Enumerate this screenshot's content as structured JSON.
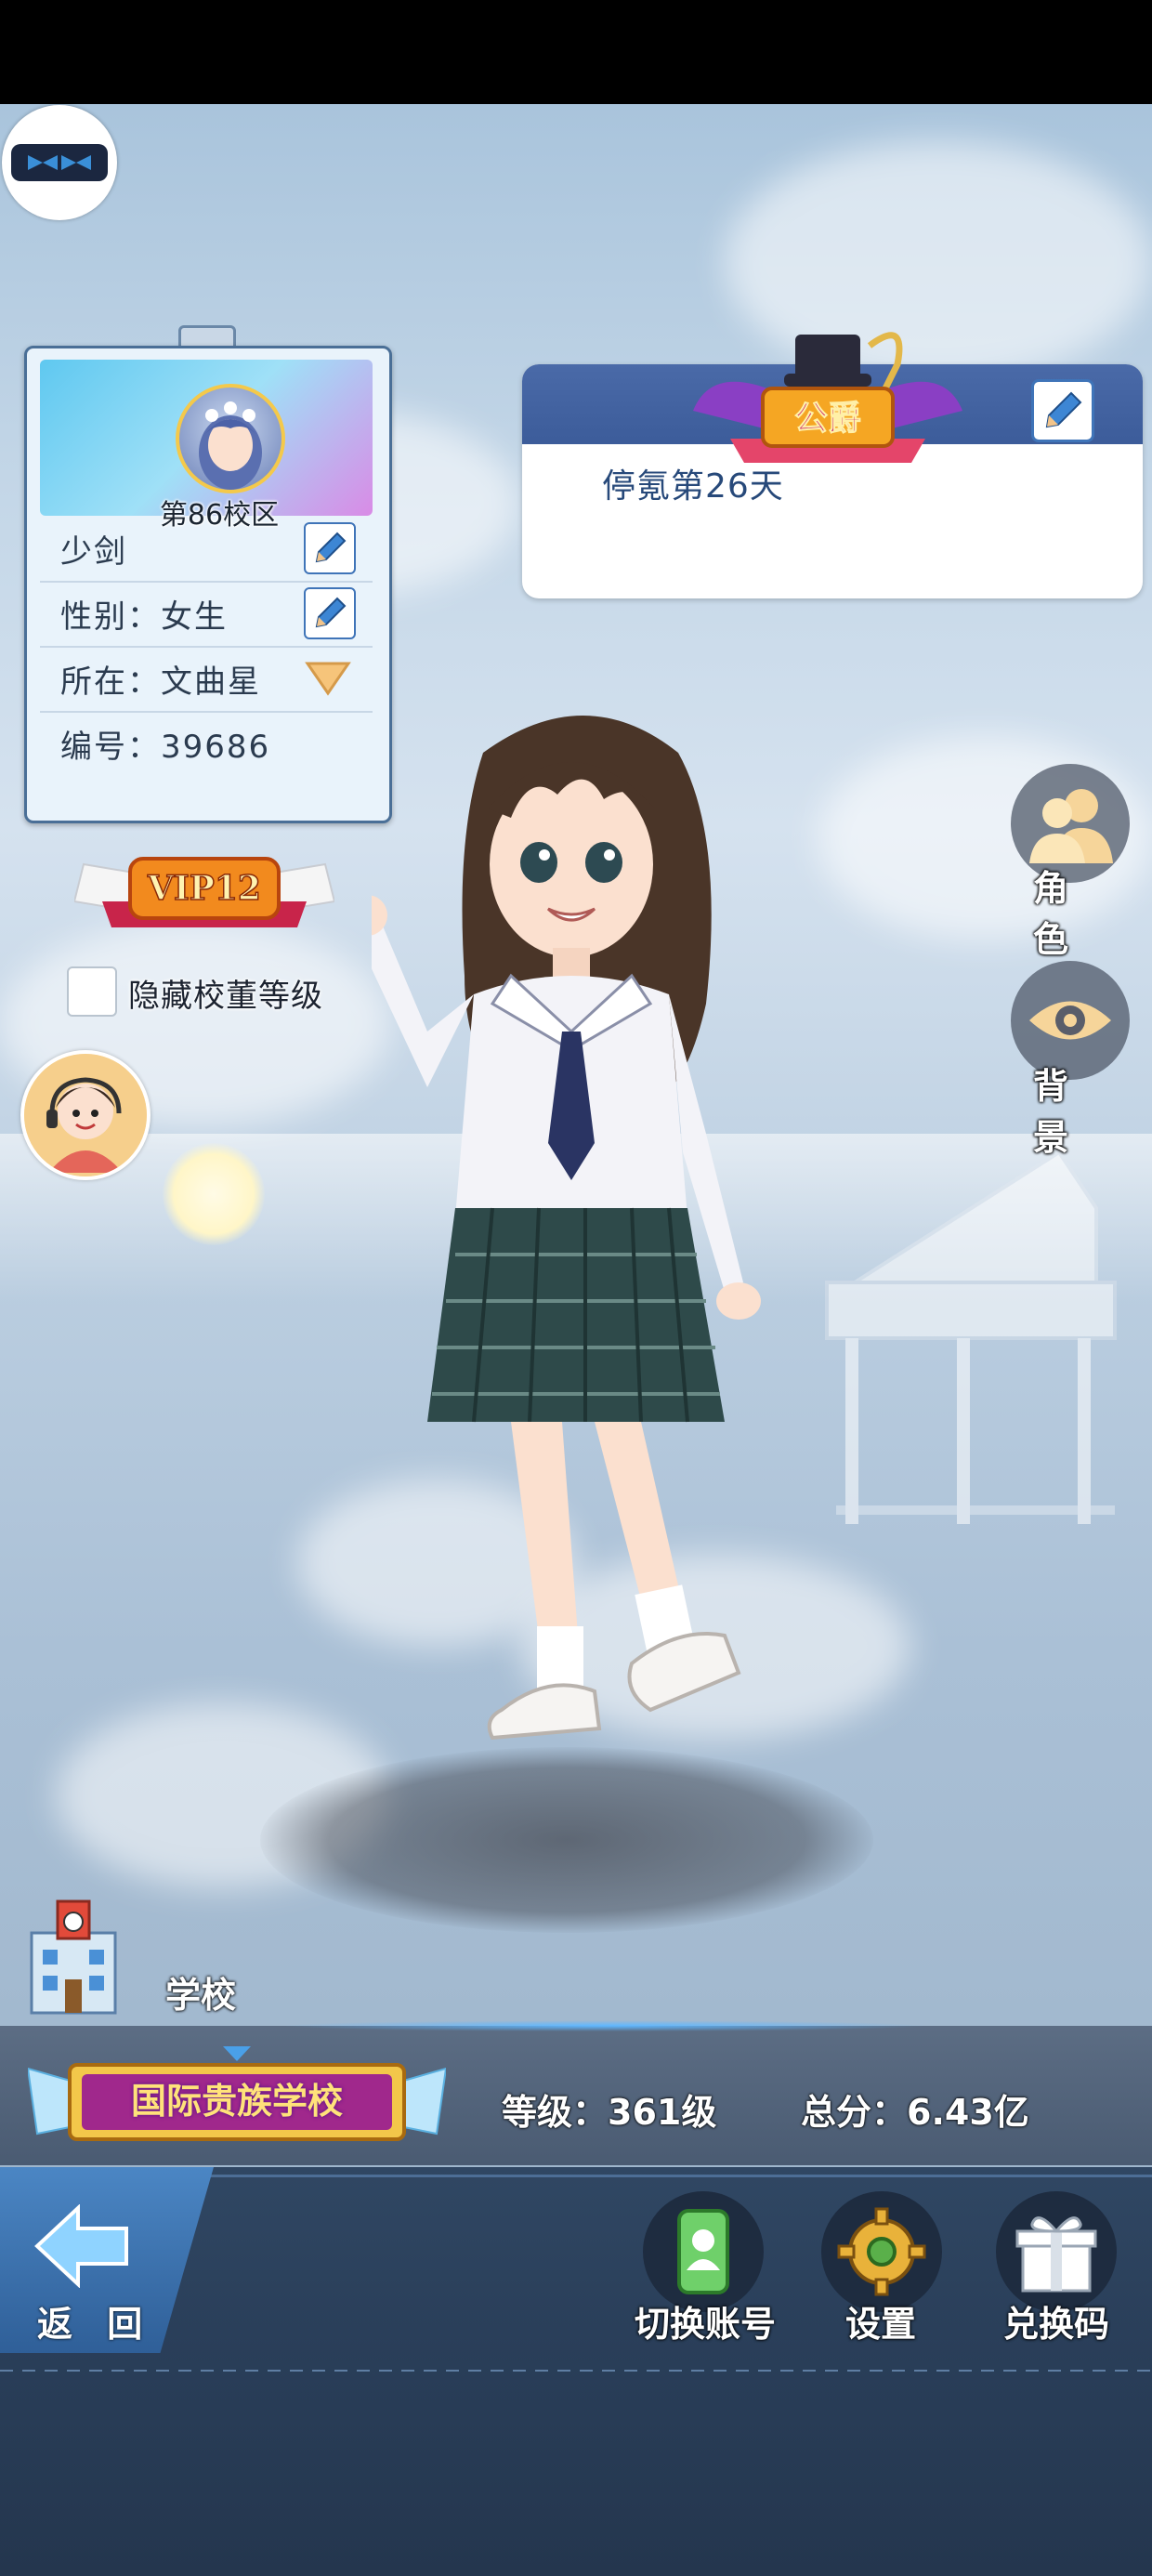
{
  "profile": {
    "campus": "第86校区",
    "name": "少剑",
    "gender_label": "性别：",
    "gender_value": "女生",
    "location_label": "所在：",
    "location_value": "文曲星",
    "id_label": "编号：",
    "id_value": "39686"
  },
  "vip": {
    "label": "VIP12"
  },
  "hide_level": {
    "label": "隐藏校董等级",
    "checked": false
  },
  "title_panel": {
    "badge_text": "公爵",
    "status": "停氪第26天"
  },
  "right_buttons": {
    "role": "角 色",
    "background": "背 景"
  },
  "school": {
    "section_label": "学校",
    "name": "国际贵族学校",
    "level_text": "等级：361级",
    "score_text": "总分：6.43亿"
  },
  "bottom_nav": {
    "back": "返 回",
    "switch_account": "切换账号",
    "settings": "设置",
    "redeem": "兑换码"
  },
  "colors": {
    "accent_blue": "#3f74b8",
    "panel_navy": "#3c5c9a",
    "school_gold": "#ffe27a"
  }
}
